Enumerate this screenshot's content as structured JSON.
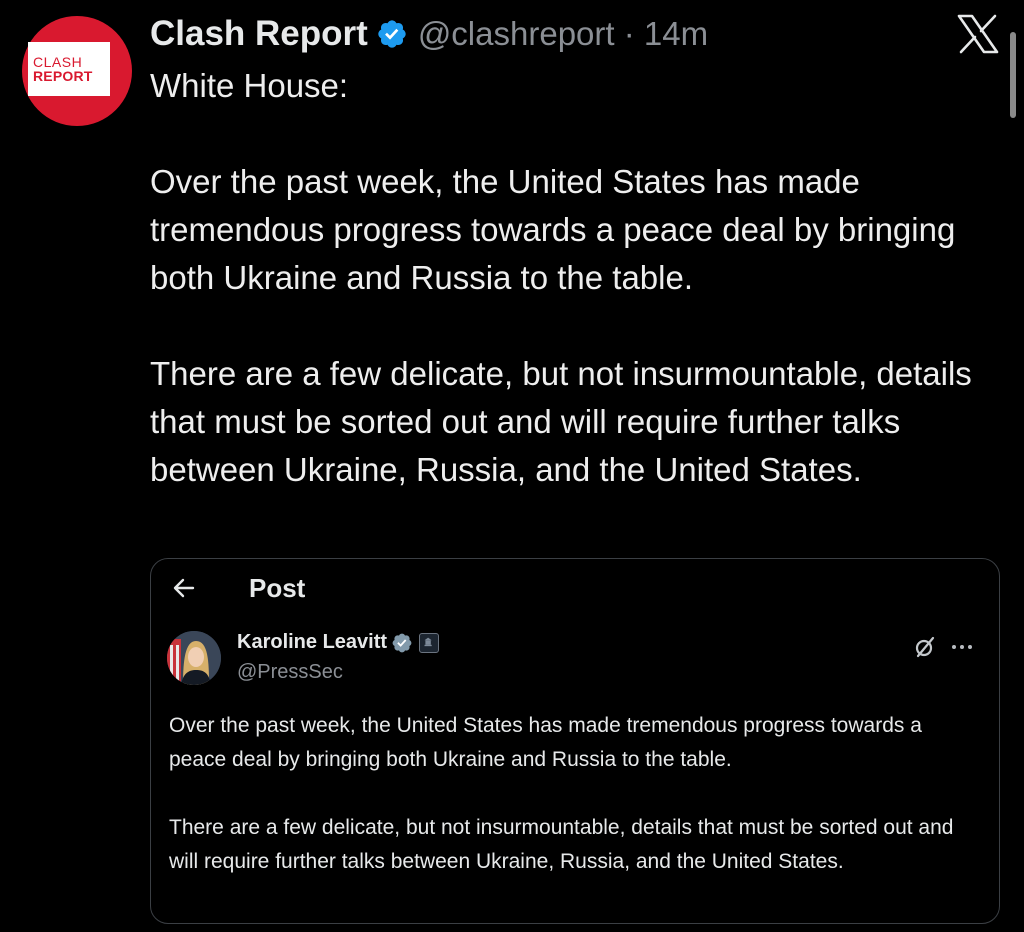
{
  "account": {
    "logo_line1": "CLASH",
    "logo_line2": "REPORT",
    "name": "Clash Report",
    "handle_time": "@clashreport · 14m"
  },
  "tweet": {
    "line1": "White House:",
    "para1": "Over the past week, the United States has made tremendous progress towards a peace deal by bringing both Ukraine and Russia to the table.",
    "para2": "There are a few delicate, but not insurmountable, details that must be sorted out and will require further talks between Ukraine, Russia, and the United States."
  },
  "embed": {
    "title": "Post",
    "author_name": "Karoline Leavitt",
    "author_handle": "@PressSec",
    "para1": "Over the past week, the United States has made tremendous progress towards a peace deal by bringing both Ukraine and Russia to the table.",
    "para2": "There are a few delicate, but not insurmountable, details that must be sorted out and will require further talks between Ukraine, Russia, and the United States."
  },
  "icons": {
    "verified": "verified-badge-icon",
    "x_logo": "x-logo-icon",
    "back": "back-arrow-icon",
    "grok": "grok-icon",
    "more": "more-icon",
    "affiliation": "government-affiliation-icon"
  },
  "colors": {
    "background": "#000000",
    "text": "#e7e9ea",
    "muted": "#8b8f95",
    "verified_blue": "#1d9bf0",
    "brand_red": "#d9192f"
  }
}
